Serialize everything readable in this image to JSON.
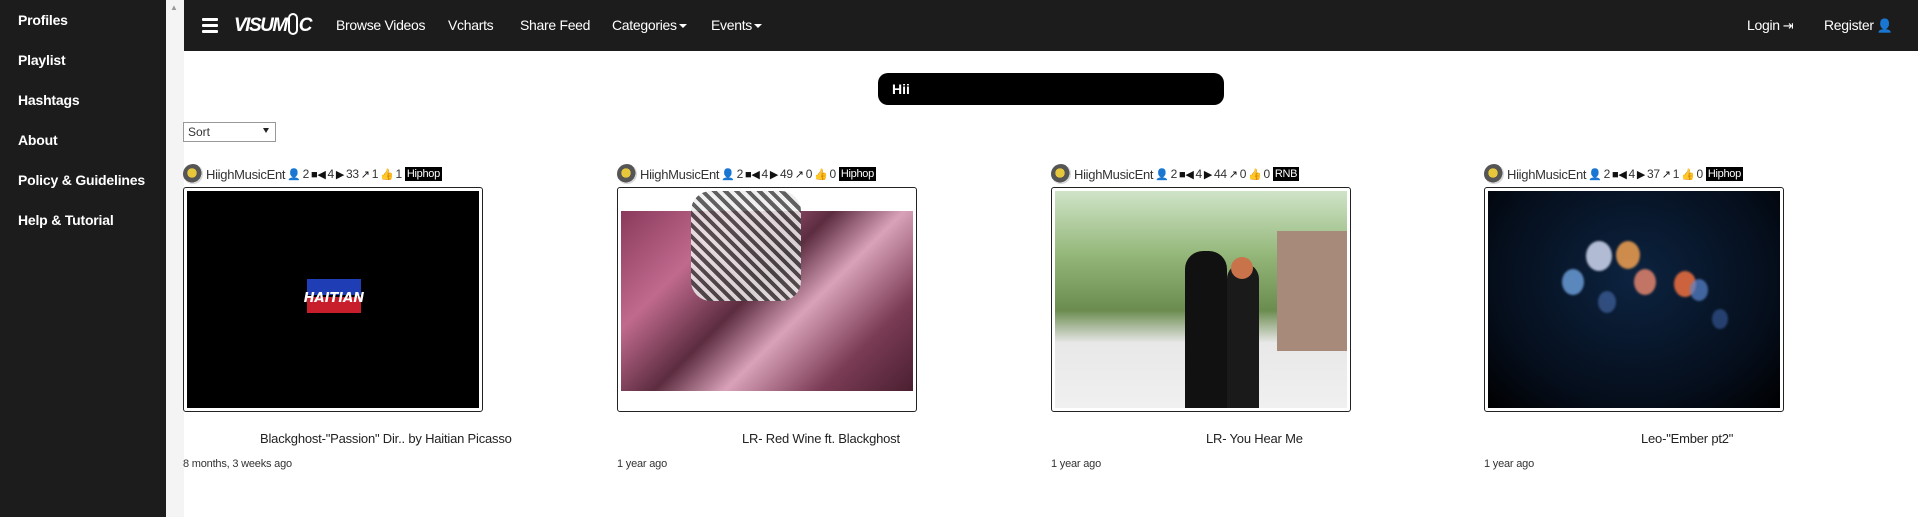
{
  "sidebar": {
    "items": [
      {
        "label": "Profiles"
      },
      {
        "label": "Playlist"
      },
      {
        "label": "Hashtags"
      },
      {
        "label": "About"
      },
      {
        "label": "Policy & Guidelines"
      },
      {
        "label": "Help & Tutorial"
      }
    ]
  },
  "header": {
    "logo_left": "VISUM",
    "logo_right": "C",
    "nav": [
      {
        "label": "Browse Videos"
      },
      {
        "label": "Vcharts"
      },
      {
        "label": "Share Feed"
      },
      {
        "label": "Categories"
      },
      {
        "label": "Events"
      }
    ],
    "login_label": "Login",
    "register_label": "Register"
  },
  "search": {
    "value": "Hii"
  },
  "sort": {
    "selected": "Sort"
  },
  "videos": [
    {
      "owner": "HiighMusicEnt",
      "followers": "2",
      "videos": "4",
      "plays": "33",
      "shares": "1",
      "likes": "1",
      "genre": "Hiphop",
      "title": "Blackghost-\"Passion\" Dir.. by Haitian Picasso",
      "ago": "8 months, 3 weeks ago",
      "thumb_text": "HAITIAN"
    },
    {
      "owner": "HiighMusicEnt",
      "followers": "2",
      "videos": "4",
      "plays": "49",
      "shares": "0",
      "likes": "0",
      "genre": "Hiphop",
      "title": "LR- Red Wine ft. Blackghost",
      "ago": "1 year ago"
    },
    {
      "owner": "HiighMusicEnt",
      "followers": "2",
      "videos": "4",
      "plays": "44",
      "shares": "0",
      "likes": "0",
      "genre": "RNB",
      "title": "LR- You Hear Me",
      "ago": "1 year ago"
    },
    {
      "owner": "HiighMusicEnt",
      "followers": "2",
      "videos": "4",
      "plays": "37",
      "shares": "1",
      "likes": "0",
      "genre": "Hiphop",
      "title": "Leo-\"Ember pt2\"",
      "ago": "1 year ago"
    }
  ],
  "colors": {
    "topbar": "#1c1c1c",
    "sidebar": "#1c1c1c",
    "search_bg": "#000000"
  },
  "icons": {
    "follower": "user-icon",
    "video": "video-camera-icon",
    "play": "play-icon",
    "share": "share-icon",
    "like": "thumbs-up-icon",
    "login": "sign-in-icon",
    "register": "user-icon",
    "menu": "hamburger-icon"
  }
}
